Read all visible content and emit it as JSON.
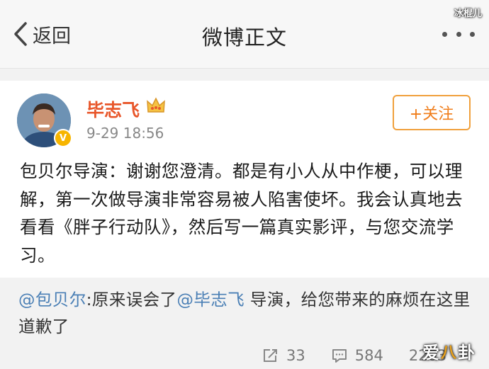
{
  "navbar": {
    "back_label": "返回",
    "title": "微博正文",
    "watermark": "冰棍儿"
  },
  "post": {
    "author": "毕志飞",
    "time": "9-29 18:56",
    "follow_label": "+关注",
    "text": "包贝尔导演：谢谢您澄清。都是有小人从中作梗，可以理解，第一次做导演非常容易被人陷害使坏。我会认真地去看看《胖子行动队》，然后写一篇真实影评，与您交流学习。"
  },
  "repost": {
    "mention1": "@包贝尔",
    "text1": ":原来误会了",
    "mention2": "@毕志飞",
    "text2": " 导演，给您带来的麻烦在这里道歉了",
    "repost_count": "33",
    "comment_count": "584",
    "like_count": "2203"
  },
  "watermark_br": {
    "part1": "爱",
    "part2": "八",
    "part3": "卦"
  },
  "colors": {
    "accent_orange": "#f07d1a",
    "name_red": "#e8562a",
    "link_blue": "#4a7fb5"
  },
  "icons": [
    "chevron-left-icon",
    "more-dots-icon",
    "crown-icon",
    "verified-icon",
    "repost-icon",
    "comment-icon"
  ]
}
